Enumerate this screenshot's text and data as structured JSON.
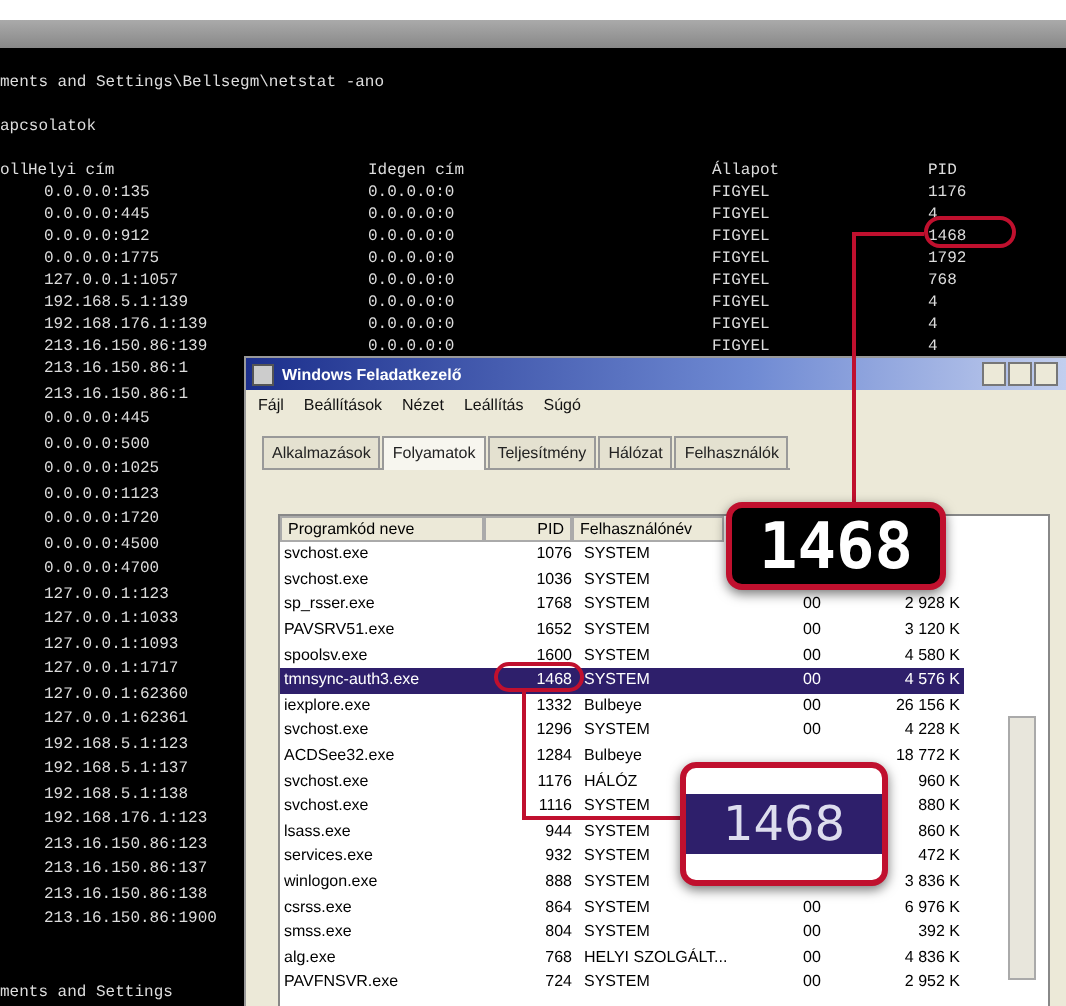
{
  "console": {
    "command": "ments and Settings\\Bellsegm\\netstat -ano",
    "subtitle": "apcsolatok",
    "columns": [
      "oll",
      "Helyi cím",
      "Idegen cím",
      "Állapot",
      "PID"
    ],
    "rows": [
      {
        "local": "0.0.0.0:135",
        "foreign": "0.0.0.0:0",
        "state": "FIGYEL",
        "pid": "1176"
      },
      {
        "local": "0.0.0.0:445",
        "foreign": "0.0.0.0:0",
        "state": "FIGYEL",
        "pid": "4"
      },
      {
        "local": "0.0.0.0:912",
        "foreign": "0.0.0.0:0",
        "state": "FIGYEL",
        "pid": "1468"
      },
      {
        "local": "0.0.0.0:1775",
        "foreign": "0.0.0.0:0",
        "state": "FIGYEL",
        "pid": "1792"
      },
      {
        "local": "127.0.0.1:1057",
        "foreign": "0.0.0.0:0",
        "state": "FIGYEL",
        "pid": "768"
      },
      {
        "local": "192.168.5.1:139",
        "foreign": "0.0.0.0:0",
        "state": "FIGYEL",
        "pid": "4"
      },
      {
        "local": "192.168.176.1:139",
        "foreign": "0.0.0.0:0",
        "state": "FIGYEL",
        "pid": "4"
      },
      {
        "local": "213.16.150.86:139",
        "foreign": "0.0.0.0:0",
        "state": "FIGYEL",
        "pid": "4"
      },
      {
        "local": "213.16.150.86:1"
      },
      {
        "local": "213.16.150.86:1"
      },
      {
        "local": "0.0.0.0:445"
      },
      {
        "local": "0.0.0.0:500"
      },
      {
        "local": "0.0.0.0:1025"
      },
      {
        "local": "0.0.0.0:1123"
      },
      {
        "local": "0.0.0.0:1720"
      },
      {
        "local": "0.0.0.0:4500"
      },
      {
        "local": "0.0.0.0:4700"
      },
      {
        "local": "127.0.0.1:123"
      },
      {
        "local": "127.0.0.1:1033"
      },
      {
        "local": "127.0.0.1:1093"
      },
      {
        "local": "127.0.0.1:1717"
      },
      {
        "local": "127.0.0.1:62360"
      },
      {
        "local": "127.0.0.1:62361"
      },
      {
        "local": "192.168.5.1:123"
      },
      {
        "local": "192.168.5.1:137"
      },
      {
        "local": "192.168.5.1:138"
      },
      {
        "local": "192.168.176.1:123"
      },
      {
        "local": "213.16.150.86:123"
      },
      {
        "local": "213.16.150.86:137"
      },
      {
        "local": "213.16.150.86:138"
      },
      {
        "local": "213.16.150.86:1900"
      }
    ],
    "footer": "ments and Settings"
  },
  "task_manager": {
    "title": "Windows Feladatkezelő",
    "menu": [
      "Fájl",
      "Beállítások",
      "Nézet",
      "Leállítás",
      "Súgó"
    ],
    "tabs": [
      {
        "label": "Alkalmazások",
        "selected": false
      },
      {
        "label": "Folyamatok",
        "selected": true
      },
      {
        "label": "Teljesítmény",
        "selected": false
      },
      {
        "label": "Hálózat",
        "selected": false
      },
      {
        "label": "Felhasználók",
        "selected": false
      }
    ],
    "columns": [
      "Programkód neve",
      "PID",
      "Felhasználónév"
    ],
    "processes": [
      {
        "name": "svchost.exe",
        "pid": "1076",
        "user": "SYSTEM",
        "selected": false
      },
      {
        "name": "svchost.exe",
        "pid": "1036",
        "user": "SYSTEM",
        "selected": false
      },
      {
        "name": "sp_rsser.exe",
        "pid": "1768",
        "user": "SYSTEM",
        "cpu": "00",
        "mem": "2 928 K",
        "selected": false
      },
      {
        "name": "PAVSRV51.exe",
        "pid": "1652",
        "user": "SYSTEM",
        "cpu": "00",
        "mem": "3 120 K",
        "selected": false
      },
      {
        "name": "spoolsv.exe",
        "pid": "1600",
        "user": "SYSTEM",
        "cpu": "00",
        "mem": "4 580 K",
        "selected": false
      },
      {
        "name": "tmnsync-auth3.exe",
        "pid": "1468",
        "user": "SYSTEM",
        "cpu": "00",
        "mem": "4 576 K",
        "selected": true
      },
      {
        "name": "iexplore.exe",
        "pid": "1332",
        "user": "Bulbeye",
        "cpu": "00",
        "mem": "26 156 K",
        "selected": false
      },
      {
        "name": "svchost.exe",
        "pid": "1296",
        "user": "SYSTEM",
        "cpu": "00",
        "mem": "4 228 K",
        "selected": false
      },
      {
        "name": "ACDSee32.exe",
        "pid": "1284",
        "user": "Bulbeye",
        "mem": "18 772 K",
        "selected": false
      },
      {
        "name": "svchost.exe",
        "pid": "1176",
        "user": "HÁLÓZ",
        "mem": "960 K",
        "selected": false
      },
      {
        "name": "svchost.exe",
        "pid": "1116",
        "user": "SYSTEM",
        "mem": "880 K",
        "selected": false
      },
      {
        "name": "lsass.exe",
        "pid": "944",
        "user": "SYSTEM",
        "mem": "860 K",
        "selected": false
      },
      {
        "name": "services.exe",
        "pid": "932",
        "user": "SYSTEM",
        "mem": "472 K",
        "selected": false
      },
      {
        "name": "winlogon.exe",
        "pid": "888",
        "user": "SYSTEM",
        "mem": "3 836 K",
        "selected": false
      },
      {
        "name": "csrss.exe",
        "pid": "864",
        "user": "SYSTEM",
        "cpu": "00",
        "mem": "6 976 K",
        "selected": false
      },
      {
        "name": "smss.exe",
        "pid": "804",
        "user": "SYSTEM",
        "cpu": "00",
        "mem": "392 K",
        "selected": false
      },
      {
        "name": "alg.exe",
        "pid": "768",
        "user": "HELYI SZOLGÁLT...",
        "cpu": "00",
        "mem": "4 836 K",
        "selected": false
      },
      {
        "name": "PAVFNSVR.exe",
        "pid": "724",
        "user": "SYSTEM",
        "cpu": "00",
        "mem": "2 952 K",
        "selected": false
      }
    ]
  },
  "console_callout": {
    "text": "1468"
  },
  "list_callout": {
    "text": "1468"
  }
}
